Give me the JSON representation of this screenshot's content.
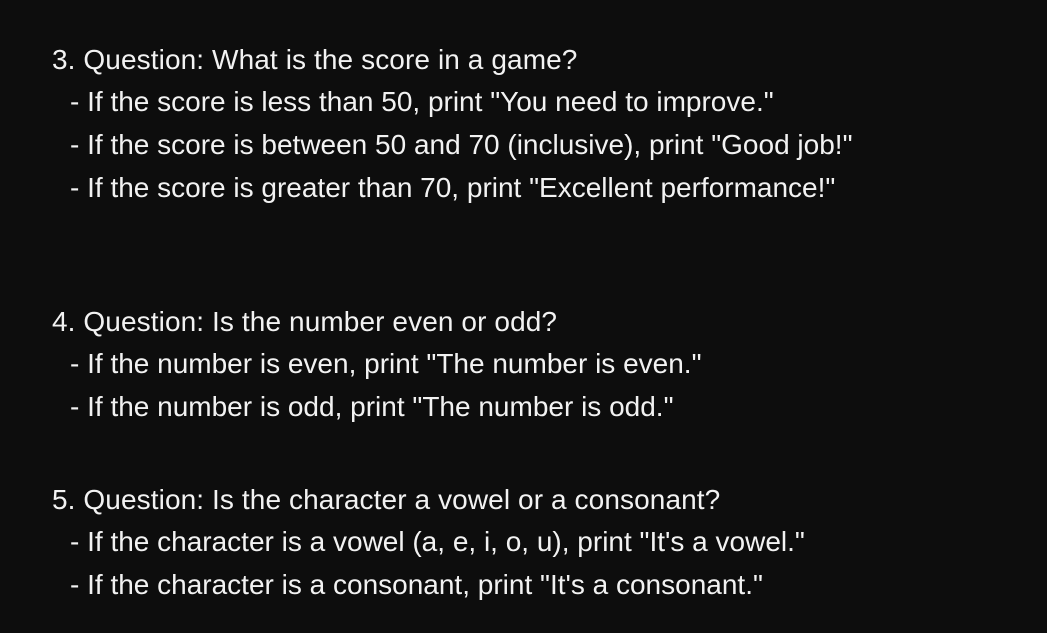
{
  "questions": [
    {
      "title": "3. Question: What is the score in a game?",
      "conditions": [
        "- If the score is less than 50, print \"You need to improve.\"",
        "- If the score is between 50 and 70 (inclusive), print \"Good job!\"",
        "- If the score is greater than 70, print \"Excellent performance!\""
      ]
    },
    {
      "title": "4. Question: Is the number even or odd?",
      "conditions": [
        "- If the number is even, print \"The number is even.\"",
        "- If the number is odd, print \"The number is odd.\""
      ]
    },
    {
      "title": "5. Question: Is the character a vowel or a consonant?",
      "conditions": [
        "- If the character is a vowel (a, e, i, o, u), print \"It's a vowel.\"",
        "- If the character is a consonant, print \"It's a consonant.\""
      ]
    }
  ],
  "colors": {
    "background": "#0d0d0d",
    "text": "#f2f2f2"
  }
}
